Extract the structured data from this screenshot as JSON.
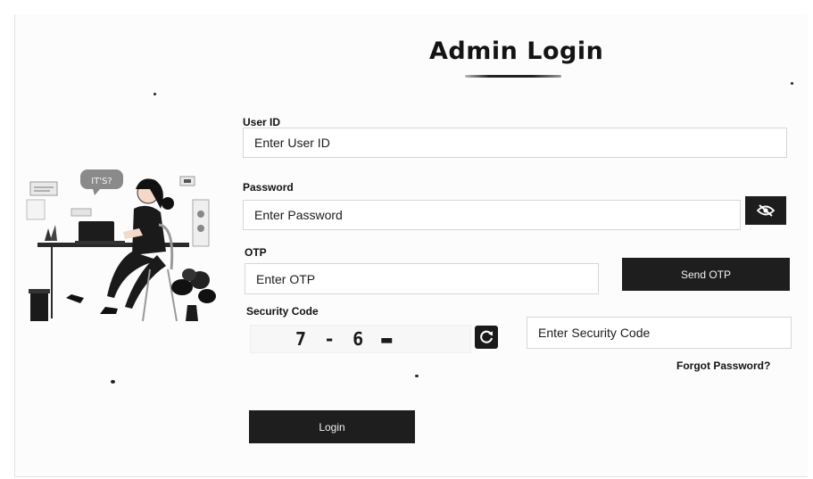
{
  "login": {
    "title": "Admin Login",
    "user_id": {
      "label": "User ID",
      "placeholder": "Enter User ID"
    },
    "password": {
      "label": "Password",
      "placeholder": "Enter Password",
      "toggle_icon": "eye-slash-icon"
    },
    "otp": {
      "label": "OTP",
      "placeholder": "Enter OTP",
      "send_button": "Send OTP"
    },
    "security_code": {
      "label": "Security Code",
      "captcha_text": "7 - 6 ▬",
      "refresh_icon": "refresh-icon",
      "placeholder": "Enter Security Code"
    },
    "forgot_password": "Forgot Password?",
    "login_button": "Login"
  },
  "illustration": {
    "speech_bubble_text": "IT'S?",
    "icon": "woman-at-laptop-illustration"
  },
  "colors": {
    "button_bg": "#1e1e1e",
    "button_text": "#f3f3f3",
    "field_border": "#d6d6d6",
    "page_bg": "#fcfcfc"
  }
}
